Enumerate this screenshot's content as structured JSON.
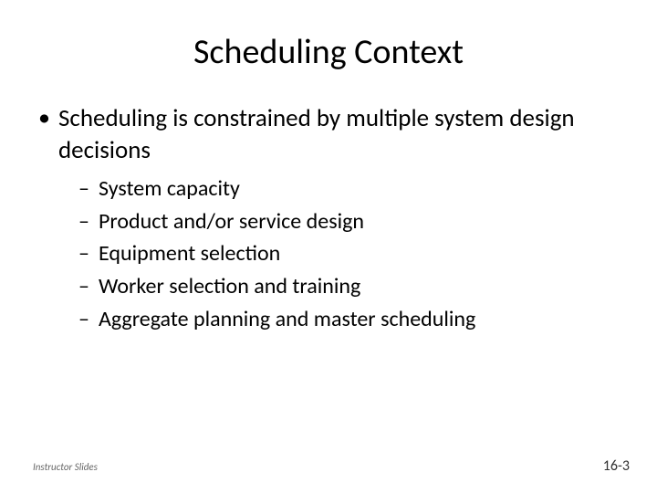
{
  "title": "Scheduling Context",
  "bullets": [
    {
      "text": "Scheduling is constrained by multiple system design decisions",
      "sub": [
        "System capacity",
        "Product and/or service design",
        "Equipment selection",
        "Worker selection and training",
        "Aggregate planning and master scheduling"
      ]
    }
  ],
  "footer_left": "Instructor Slides",
  "footer_right": "16-3"
}
